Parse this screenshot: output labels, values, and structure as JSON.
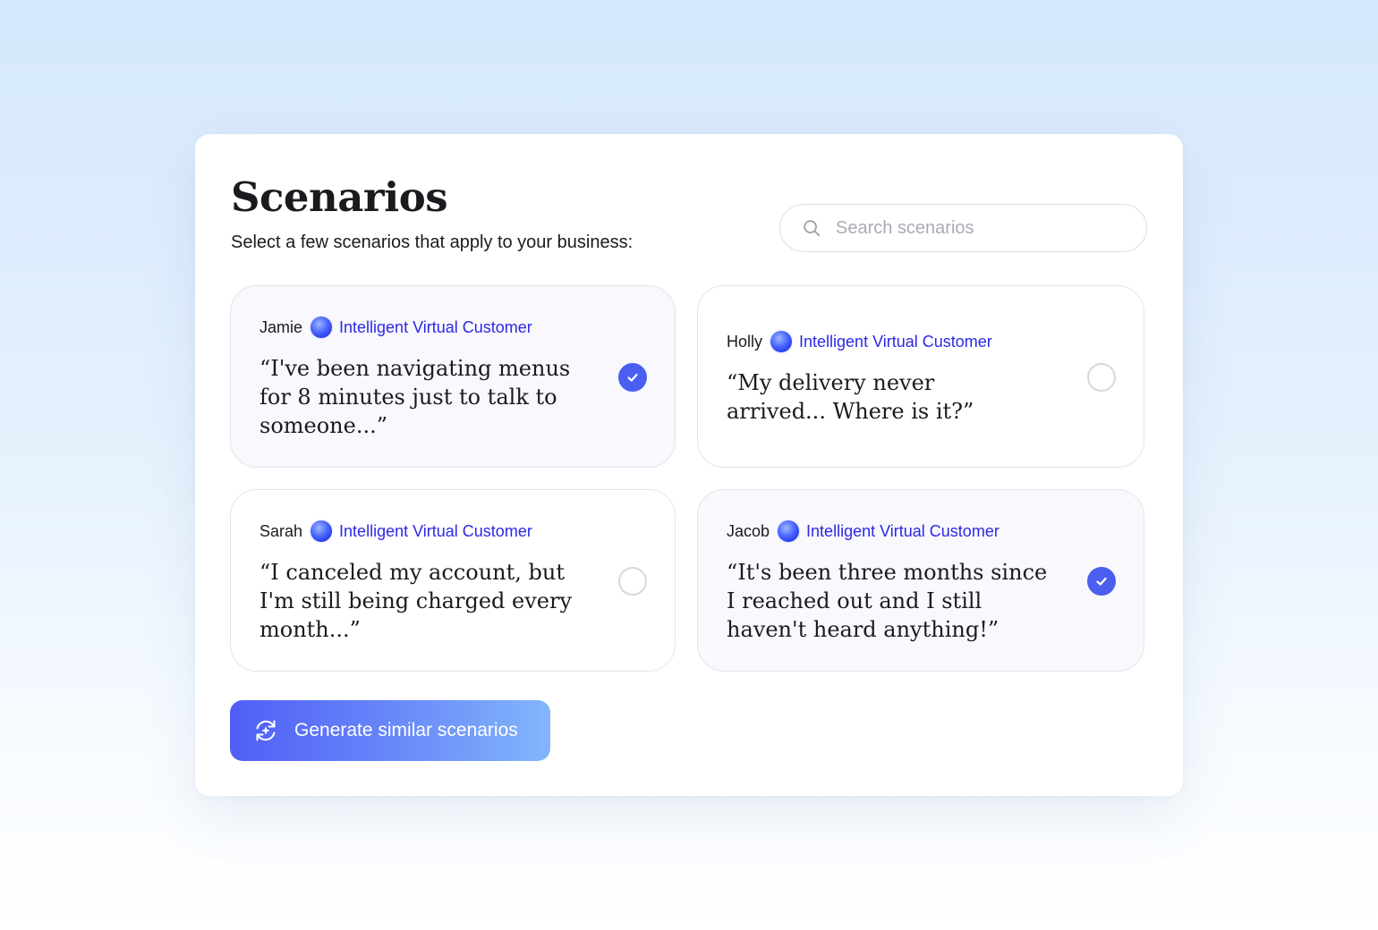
{
  "page": {
    "title": "Scenarios",
    "subtitle": "Select a few scenarios that apply to your business:"
  },
  "search": {
    "placeholder": "Search scenarios",
    "value": ""
  },
  "cards": [
    {
      "name": "Jamie",
      "tag": "Intelligent Virtual Customer",
      "quote": "“I've been navigating menus for 8 minutes just to talk to someone...”",
      "selected": true
    },
    {
      "name": "Holly",
      "tag": "Intelligent Virtual Customer",
      "quote": "“My delivery never arrived... Where is it?”",
      "selected": false
    },
    {
      "name": "Sarah",
      "tag": "Intelligent Virtual Customer",
      "quote": "“I canceled my account, but I'm still being charged every month...”",
      "selected": false
    },
    {
      "name": "Jacob",
      "tag": "Intelligent Virtual Customer",
      "quote": "“It's been three months since I reached out and I still haven't heard anything!”",
      "selected": true
    }
  ],
  "actions": {
    "generate_label": "Generate similar scenarios"
  },
  "colors": {
    "accent": "#4a5ef0",
    "tag_text": "#2d28e6",
    "selected_card_bg": "#f8f8fd"
  },
  "icons": {
    "search": "search-icon",
    "check": "check-icon",
    "orb": "virtual-customer-orb-icon",
    "generate": "refresh-sparkle-icon"
  }
}
